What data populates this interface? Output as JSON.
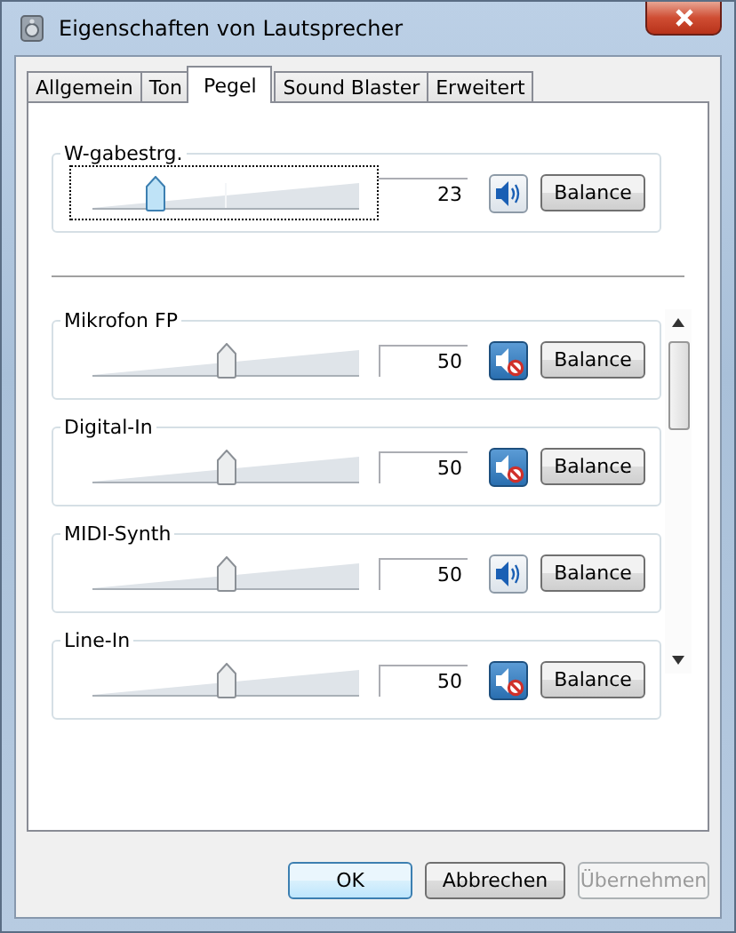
{
  "window": {
    "title": "Eigenschaften von Lautsprecher"
  },
  "tabs": [
    {
      "label": "Allgemein",
      "selected": false
    },
    {
      "label": "Ton",
      "selected": false
    },
    {
      "label": "Pegel",
      "selected": true
    },
    {
      "label": "Sound Blaster",
      "selected": false
    },
    {
      "label": "Erweitert",
      "selected": false
    }
  ],
  "master": {
    "name": "W-gabestrg.",
    "level": 0.23,
    "value": "23",
    "muted": false,
    "focused": true,
    "balance": "Balance"
  },
  "channels": [
    {
      "name": "Mikrofon FP",
      "level": 0.5,
      "value": "50",
      "muted": true,
      "balance": "Balance"
    },
    {
      "name": "Digital-In",
      "level": 0.5,
      "value": "50",
      "muted": true,
      "balance": "Balance"
    },
    {
      "name": "MIDI-Synth",
      "level": 0.5,
      "value": "50",
      "muted": false,
      "balance": "Balance"
    },
    {
      "name": "Line-In",
      "level": 0.5,
      "value": "50",
      "muted": true,
      "balance": "Balance"
    }
  ],
  "buttons": [
    {
      "label": "OK",
      "default": true,
      "disabled": false
    },
    {
      "label": "Abbrechen",
      "default": false,
      "disabled": false
    },
    {
      "label": "Übernehmen",
      "default": false,
      "disabled": true
    }
  ]
}
